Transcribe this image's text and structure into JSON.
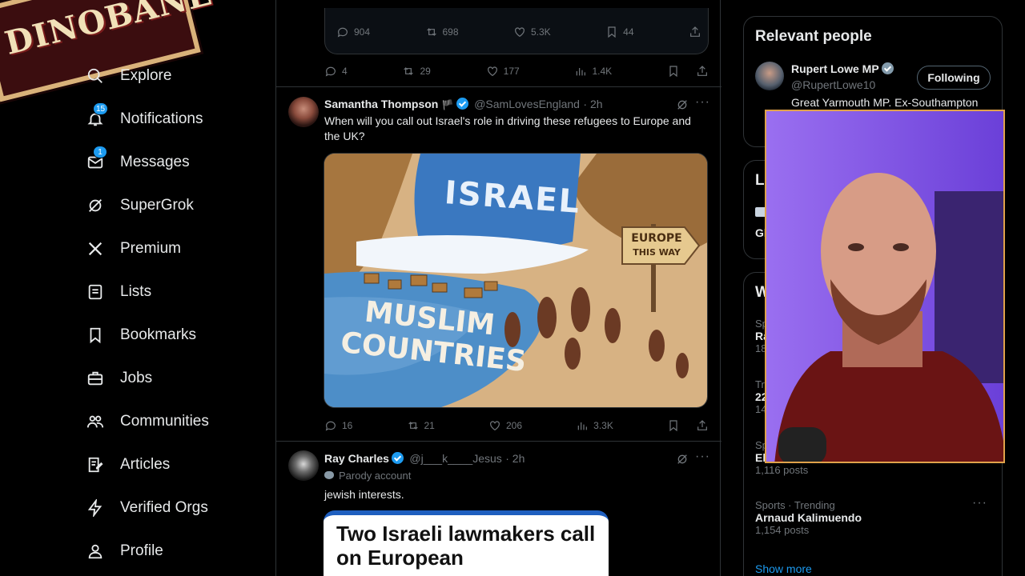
{
  "logo": {
    "text": "DINOBANE"
  },
  "nav": [
    {
      "label": "Explore",
      "icon": "search-icon"
    },
    {
      "label": "Notifications",
      "icon": "bell-icon",
      "badge": "15"
    },
    {
      "label": "Messages",
      "icon": "mail-icon",
      "badge": "1"
    },
    {
      "label": "SuperGrok",
      "icon": "grok-icon"
    },
    {
      "label": "Premium",
      "icon": "x-logo-icon"
    },
    {
      "label": "Lists",
      "icon": "list-icon"
    },
    {
      "label": "Bookmarks",
      "icon": "bookmark-icon"
    },
    {
      "label": "Jobs",
      "icon": "briefcase-icon"
    },
    {
      "label": "Communities",
      "icon": "people-icon"
    },
    {
      "label": "Articles",
      "icon": "article-icon"
    },
    {
      "label": "Verified Orgs",
      "icon": "lightning-icon"
    },
    {
      "label": "Profile",
      "icon": "person-icon"
    }
  ],
  "quoted_card": {
    "replies": "904",
    "reposts": "698",
    "likes": "5.3K",
    "bookmarks": "44"
  },
  "prev_tweet": {
    "replies": "4",
    "reposts": "29",
    "likes": "177",
    "views": "1.4K"
  },
  "tweet1": {
    "name": "Samantha Thompson",
    "flag": "🏴",
    "handle": "@SamLovesEngland",
    "time": "· 2h",
    "text": "When will you call out Israel's role in driving these refugees to Europe and the UK?",
    "image_text": {
      "top": "ISRAEL",
      "bottom1": "MUSLIM",
      "bottom2": "COUNTRIES",
      "sign1": "EUROPE",
      "sign2": "THIS WAY"
    },
    "replies": "16",
    "reposts": "21",
    "likes": "206",
    "views": "3.3K"
  },
  "tweet2": {
    "name": "Ray Charles",
    "handle": "@j___k____Jesus",
    "time": "· 2h",
    "parody": "Parody account",
    "text": "jewish interests.",
    "news_headline": "Two Israeli lawmakers call on European"
  },
  "relevant": {
    "title": "Relevant people",
    "name": "Rupert Lowe MP",
    "handle": "@RupertLowe10",
    "bio": "Great Yarmouth MP. Ex-Southampton",
    "button": "Following"
  },
  "partial": {
    "p2_title": "Li",
    "p2_line": "Gl",
    "p3_title": "W",
    "rows": [
      {
        "meta": "Sp",
        "title": "Ra",
        "sub": "18"
      },
      {
        "meta": "Tr",
        "title": "22",
        "sub": "14"
      },
      {
        "meta": "Sp",
        "title": "El",
        "sub": "1,116 posts"
      }
    ]
  },
  "trend": {
    "meta": "Sports · Trending",
    "title": "Arnaud Kalimuendo",
    "posts": "1,154 posts",
    "show_more": "Show more"
  },
  "colors": {
    "accent": "#1d9bf0",
    "bg": "#000000",
    "border": "#2f3336",
    "muted": "#71767b"
  }
}
